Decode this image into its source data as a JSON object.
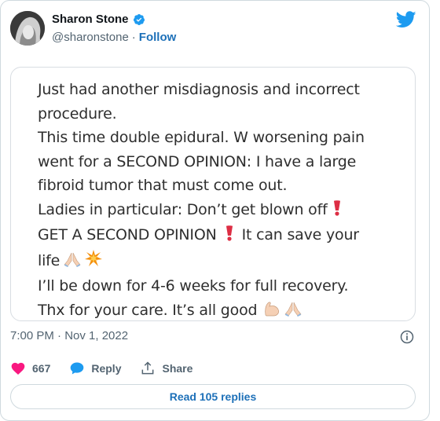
{
  "header": {
    "name": "Sharon Stone",
    "handle": "@sharonstone",
    "separator": "·",
    "follow": "Follow"
  },
  "tweet": {
    "lines": [
      "Just had another misdiagnosis and incorrect",
      "procedure.",
      "This time double epidural. W worsening pain",
      "went for a SECOND OPINION: I have a large",
      "fibroid tumor that must come out.",
      "Ladies in particular: Don’t get blown off",
      "GET A SECOND OPINION",
      "It can save your",
      "life",
      "I’ll be down for 4-6 weeks for full recovery.",
      "Thx for your care. It’s all good"
    ]
  },
  "meta": {
    "time": "7:00 PM · Nov 1, 2022"
  },
  "actions": {
    "likes": "667",
    "reply": "Reply",
    "share": "Share"
  },
  "footer": {
    "read_replies": "Read 105 replies"
  },
  "colors": {
    "like": "#f91880",
    "reply": "#1d9bf0",
    "link": "#1d70b8",
    "verified": "#1d9bf0",
    "twitter": "#1d9bf0"
  },
  "icons": [
    "verified-badge-icon",
    "twitter-bird-icon",
    "info-icon",
    "heart-icon",
    "reply-bubble-icon",
    "share-icon",
    "exclamation-emoji",
    "praying-hands-emoji",
    "collision-emoji",
    "flexed-biceps-emoji"
  ]
}
